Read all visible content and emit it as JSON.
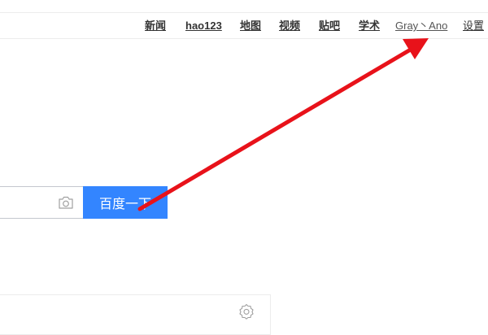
{
  "topnav": {
    "news": "新闻",
    "hao123": "hao123",
    "map": "地图",
    "video": "视频",
    "tieba": "贴吧",
    "academic": "学术",
    "user": "Gray丶Ano",
    "settings": "设置"
  },
  "search": {
    "button_label": "百度一下",
    "input_value": ""
  },
  "icons": {
    "camera": "camera-icon",
    "gear": "gear-icon"
  },
  "colors": {
    "search_button": "#3385ff",
    "annotation_arrow": "#e8121a"
  }
}
